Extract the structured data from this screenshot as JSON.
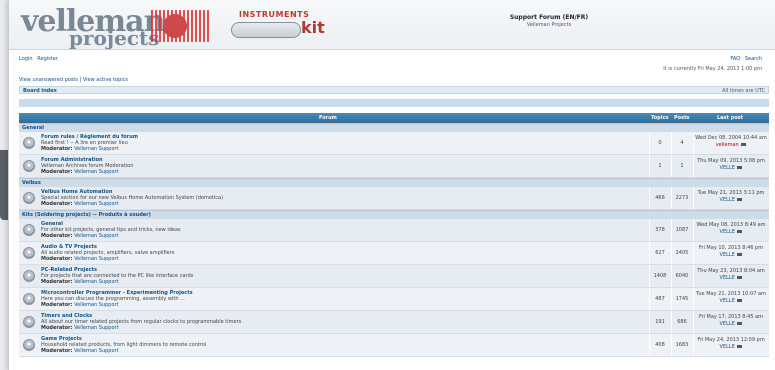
{
  "header": {
    "logo_main": "velleman",
    "logo_sub": "projects",
    "instruments_title": "INSTRUMENTS",
    "kit_label": "kit",
    "site_title": "Support Forum (EN/FR)",
    "site_desc": "Velleman Projects"
  },
  "nav": {
    "login": "Login",
    "register": "Register",
    "faq": "FAQ",
    "search": "Search",
    "current_time": "It is currently Fri May 24, 2013 1:00 pm",
    "unanswered": "View unanswered posts | View active topics",
    "board_index": "Board index",
    "timezone": "All times are UTC"
  },
  "table": {
    "col_forum": "Forum",
    "col_topics": "Topics",
    "col_posts": "Posts",
    "col_last": "Last post"
  },
  "categories": [
    {
      "name": "General",
      "forums": [
        {
          "title": "Forum rules / Règlement du forum",
          "desc": "Read first ! -- A lire en premier lieu",
          "mod_label": "Moderator:",
          "moderator": "Velleman Support",
          "topics": "0",
          "posts": "4",
          "last_date": "Wed Dec 08, 2004 10:44 am",
          "last_by": "velleman"
        },
        {
          "title": "Forum Administration",
          "desc": "Velleman Archives forum Moderation",
          "mod_label": "Moderator:",
          "moderator": "Velleman Support",
          "topics": "1",
          "posts": "1",
          "last_date": "Thu May 09, 2013 5:08 pm",
          "last_by": "VELLE"
        }
      ]
    },
    {
      "name": "Velbus",
      "forums": [
        {
          "title": "Velbus Home Automation",
          "desc": "Special section for our new Velbus Home Automation System (domotica)",
          "mod_label": "Moderator:",
          "moderator": "Velleman Support",
          "topics": "466",
          "posts": "2273",
          "last_date": "Tue May 21, 2013 3:11 pm",
          "last_by": "VELLE"
        }
      ]
    },
    {
      "name": "Kits (Soldering projects) -- Produits à souder)",
      "forums": [
        {
          "title": "General",
          "desc": "For other kit projects, general tips and tricks, new ideas",
          "mod_label": "Moderator:",
          "moderator": "Velleman Support",
          "topics": "378",
          "posts": "1087",
          "last_date": "Wed May 08, 2013 8:49 am",
          "last_by": "VELLE"
        },
        {
          "title": "Audio & TV Projects",
          "desc": "All audio related projects, amplifiers, valve amplifiers",
          "mod_label": "Moderator:",
          "moderator": "Velleman Support",
          "topics": "627",
          "posts": "2405",
          "last_date": "Fri May 10, 2013 8:46 pm",
          "last_by": "VELLE"
        },
        {
          "title": "PC-Related Projects",
          "desc": "For projects that are connected to the PC like interface cards",
          "mod_label": "Moderator:",
          "moderator": "Velleman Support",
          "topics": "1408",
          "posts": "6040",
          "last_date": "Thu May 23, 2013 8:04 am",
          "last_by": "VELLE"
        },
        {
          "title": "Microcontroller Programmer - Experimenting Projects",
          "desc": "Here you can discuss the programming, assembly with ...",
          "mod_label": "Moderator:",
          "moderator": "Velleman Support",
          "topics": "487",
          "posts": "1745",
          "last_date": "Tue May 21, 2013 10:07 am",
          "last_by": "VELLE"
        },
        {
          "title": "Timers and Clocks",
          "desc": "All about our timer related projects from regular clocks to programmable timers",
          "mod_label": "Moderator:",
          "moderator": "Velleman Support",
          "topics": "191",
          "posts": "686",
          "last_date": "Fri May 17, 2013 8:45 am",
          "last_by": "VELLE"
        },
        {
          "title": "Game Projects",
          "desc": "Household related products, from light dimmers to remote control",
          "mod_label": "Moderator:",
          "moderator": "Velleman Support",
          "topics": "408",
          "posts": "1683",
          "last_date": "Fri May 24, 2013 12:09 pm",
          "last_by": "VELLE"
        }
      ]
    }
  ]
}
